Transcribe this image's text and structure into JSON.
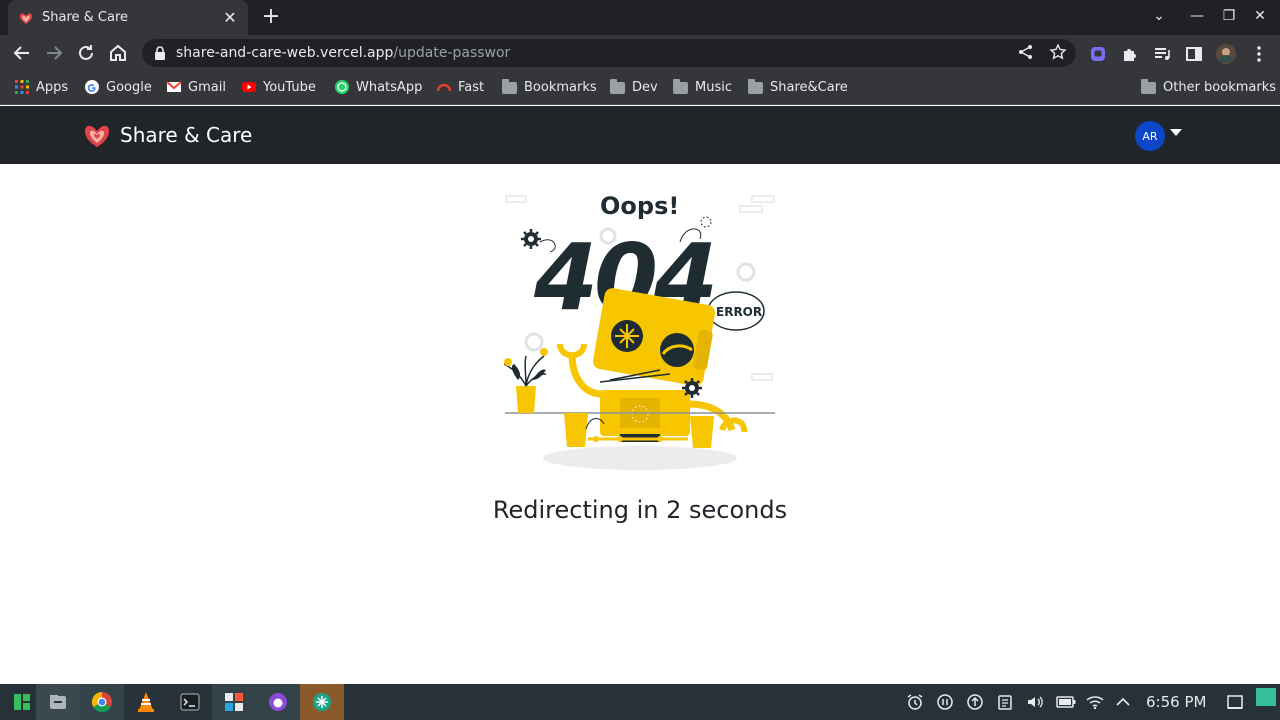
{
  "browser": {
    "tab": {
      "title": "Share & Care",
      "close_glyph": "✕"
    },
    "new_tab_glyph": "+",
    "window_controls": {
      "dropdown": "⌄",
      "minimize": "—",
      "restore": "❐",
      "close": "✕"
    },
    "url_host": "share-and-care-web.vercel.app",
    "url_path": "/update-passwor",
    "bookmarks": [
      {
        "label": "Apps",
        "icon": "apps-grid-icon"
      },
      {
        "label": "Google",
        "icon": "google-icon"
      },
      {
        "label": "Gmail",
        "icon": "gmail-icon"
      },
      {
        "label": "YouTube",
        "icon": "youtube-icon"
      },
      {
        "label": "WhatsApp",
        "icon": "whatsapp-icon"
      },
      {
        "label": "Fast",
        "icon": "fast-speed-icon"
      },
      {
        "label": "Bookmarks",
        "icon": "folder-icon"
      },
      {
        "label": "Dev",
        "icon": "folder-icon"
      },
      {
        "label": "Music",
        "icon": "folder-icon"
      },
      {
        "label": "Share&Care",
        "icon": "folder-icon"
      }
    ],
    "other_bookmarks": "Other bookmarks"
  },
  "app": {
    "brand": "Share & Care",
    "avatar_initials": "AR",
    "illustration": {
      "heading": "Oops!",
      "code": "404",
      "badge": "ERROR"
    },
    "redirect_text": "Redirecting in 2 seconds",
    "colors": {
      "navbar": "#212529",
      "avatar": "#0d47c9",
      "robot": "#f7c600",
      "dark": "#1f2d33"
    }
  },
  "taskbar": {
    "clock": "6:56 PM",
    "apps": [
      "manjaro-icon",
      "file-manager-icon",
      "chrome-icon",
      "vlc-icon",
      "terminal-icon",
      "software-center-icon",
      "github-desktop-icon",
      "app-icon"
    ]
  }
}
